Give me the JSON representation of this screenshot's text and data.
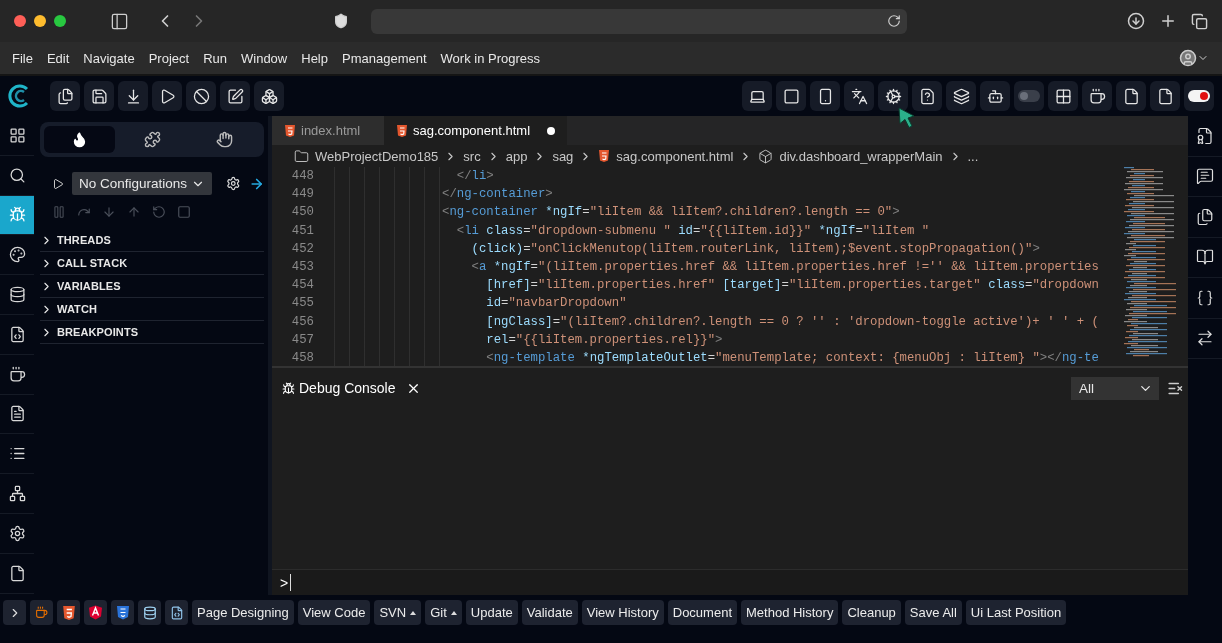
{
  "menu": [
    "File",
    "Edit",
    "Navigate",
    "Project",
    "Run",
    "Window",
    "Help",
    "Pmanagement",
    "Work in Progress"
  ],
  "toolbar": {
    "device_toggle": {
      "on": false
    },
    "record_toggle": {
      "on": true
    }
  },
  "activity_bar": [
    {
      "selected": false
    },
    {
      "selected": false
    },
    {
      "selected": true
    },
    {
      "selected": false
    },
    {
      "selected": false
    },
    {
      "selected": false
    },
    {
      "selected": false
    },
    {
      "selected": false
    },
    {
      "selected": false
    },
    {
      "selected": false
    },
    {
      "selected": false
    },
    {
      "selected": false
    }
  ],
  "debug_panel": {
    "tabs": [
      {
        "selected": true
      },
      {
        "selected": false
      },
      {
        "selected": false
      }
    ],
    "configuration": "No Configurations",
    "sections": [
      {
        "label": "THREADS",
        "expanded": false
      },
      {
        "label": "CALL STACK",
        "expanded": false
      },
      {
        "label": "VARIABLES",
        "expanded": false
      },
      {
        "label": "WATCH",
        "expanded": false
      },
      {
        "label": "BREAKPOINTS",
        "expanded": false
      }
    ]
  },
  "editor": {
    "tabs": [
      {
        "label": "index.html",
        "selected": false,
        "modified": false
      },
      {
        "label": "sag.component.html",
        "selected": true,
        "modified": true
      }
    ],
    "breadcrumb": [
      {
        "label": "WebProjectDemo185",
        "kind": "folder"
      },
      {
        "label": "src",
        "kind": "plain"
      },
      {
        "label": "app",
        "kind": "plain"
      },
      {
        "label": "sag",
        "kind": "plain"
      },
      {
        "label": "sag.component.html",
        "kind": "file"
      },
      {
        "label": "div.dashboard_wrapperMain",
        "kind": "element"
      },
      {
        "label": "...",
        "kind": "plain"
      }
    ],
    "lines": [
      {
        "number": "448",
        "code": "  </li>"
      },
      {
        "number": "449",
        "code": "</ng-container>"
      },
      {
        "number": "450",
        "code": "<ng-container *ngIf=\"liItem && liItem?.children?.length == 0\">"
      },
      {
        "number": "451",
        "code": "  <li class=\"dropdown-submenu \" id=\"{{liItem.id}}\" *ngIf=\"liItem \""
      },
      {
        "number": "452",
        "code": "    (click)=\"onClickMenutop(liItem.routerLink, liItem);$event.stopPropagation()\">"
      },
      {
        "number": "453",
        "code": "    <a *ngIf=\"(liItem.properties.href && liItem.properties.href !='' && liItem.properties"
      },
      {
        "number": "454",
        "code": "      [href]=\"liItem.properties.href\" [target]=\"liItem.properties.target\" class=\"dropdown"
      },
      {
        "number": "455",
        "code": "      id=\"navbarDropdown\""
      },
      {
        "number": "456",
        "code": "      [ngClass]=\"(liItem?.children?.length == 0 ? '' : 'dropdown-toggle active')+ ' ' + ("
      },
      {
        "number": "457",
        "code": "      rel=\"{{liItem.properties.rel}}\">"
      },
      {
        "number": "458",
        "code": "      <ng-template *ngTemplateOutlet=\"menuTemplate; context: {menuObj : liItem} \"></ng-te"
      }
    ]
  },
  "console": {
    "tab": "Debug Console",
    "filter": "All",
    "prompt": ">"
  },
  "bottom_bar": {
    "buttons": [
      {
        "label": "Page Designing",
        "dropdown": false
      },
      {
        "label": "View Code",
        "dropdown": false
      },
      {
        "label": "SVN",
        "dropdown": true
      },
      {
        "label": "Git",
        "dropdown": true
      },
      {
        "label": "Update",
        "dropdown": false
      },
      {
        "label": "Validate",
        "dropdown": false
      },
      {
        "label": "View History",
        "dropdown": false
      },
      {
        "label": "Document",
        "dropdown": false
      },
      {
        "label": "Method History",
        "dropdown": false
      },
      {
        "label": "Cleanup",
        "dropdown": false
      },
      {
        "label": "Save All",
        "dropdown": false
      },
      {
        "label": "Ui Last Position",
        "dropdown": false
      }
    ]
  }
}
